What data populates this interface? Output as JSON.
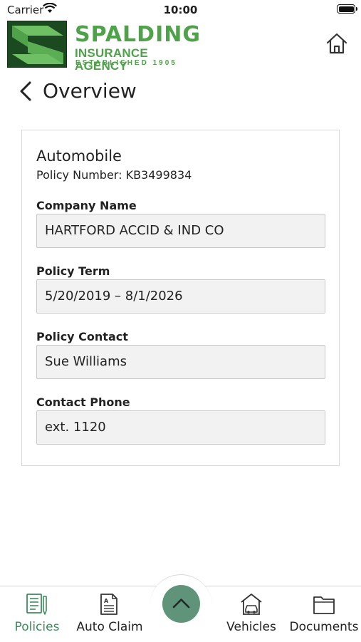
{
  "status_bar": {
    "carrier": "Carrier",
    "time": "10:00"
  },
  "header": {
    "logo_line1": "SPALDING",
    "logo_line2": "INSURANCE AGENCY",
    "logo_line3": "ESTABLISHED 1905"
  },
  "page": {
    "title": "Overview"
  },
  "policy": {
    "type": "Automobile",
    "number_text": "Policy Number: KB3499834",
    "fields": [
      {
        "label": "Company Name",
        "value": "HARTFORD ACCID & IND CO"
      },
      {
        "label": "Policy Term",
        "value": "5/20/2019 – 8/1/2026"
      },
      {
        "label": "Policy Contact",
        "value": "Sue Williams"
      },
      {
        "label": "Contact Phone",
        "value": "ext. 1120"
      }
    ]
  },
  "tabbar": {
    "tabs": [
      {
        "label": "Policies",
        "icon": "policies-icon",
        "active": true
      },
      {
        "label": "Auto Claim",
        "icon": "auto-claim-icon",
        "active": false
      },
      {
        "label": "Vehicles",
        "icon": "vehicles-icon",
        "active": false
      },
      {
        "label": "Documents",
        "icon": "documents-icon",
        "active": false
      }
    ]
  },
  "colors": {
    "brand_green": "#4fa14a",
    "logo_dark_green": "#1c4a20",
    "accent_green": "#3f8a5d",
    "up_button": "#5f947b"
  }
}
